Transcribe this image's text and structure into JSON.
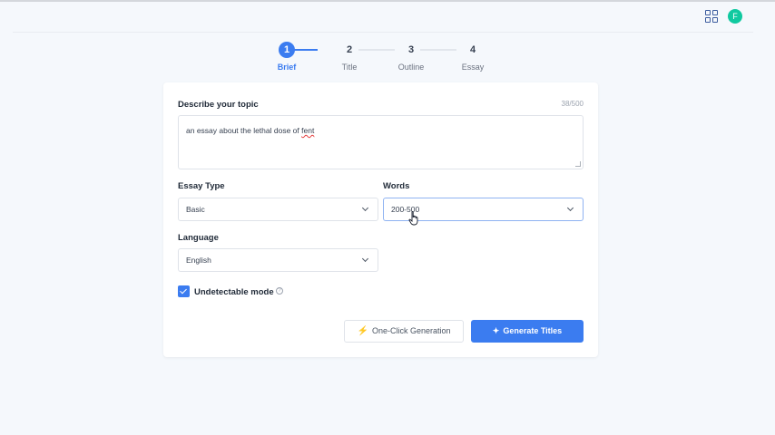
{
  "header": {
    "avatar_initial": "F",
    "icons": [
      "grid-icon"
    ]
  },
  "stepper": {
    "steps": [
      {
        "num": "1",
        "label": "Brief",
        "active": true
      },
      {
        "num": "2",
        "label": "Title",
        "active": false
      },
      {
        "num": "3",
        "label": "Outline",
        "active": false
      },
      {
        "num": "4",
        "label": "Essay",
        "active": false
      }
    ]
  },
  "form": {
    "topic_label": "Describe your topic",
    "char_count": "38/500",
    "topic_prefix": "an essay about the lethal dose of ",
    "topic_misspelled": "fent",
    "essay_type_label": "Essay Type",
    "essay_type_value": "Basic",
    "words_label": "Words",
    "words_value": "200-500",
    "language_label": "Language",
    "language_value": "English",
    "undetectable_label": "Undetectable mode",
    "undetectable_checked": true
  },
  "actions": {
    "one_click_label": "One-Click Generation",
    "generate_label": "Generate Titles"
  },
  "colors": {
    "accent": "#3b7cf0",
    "avatar": "#10c9a0",
    "bolt": "#f59e0b"
  }
}
